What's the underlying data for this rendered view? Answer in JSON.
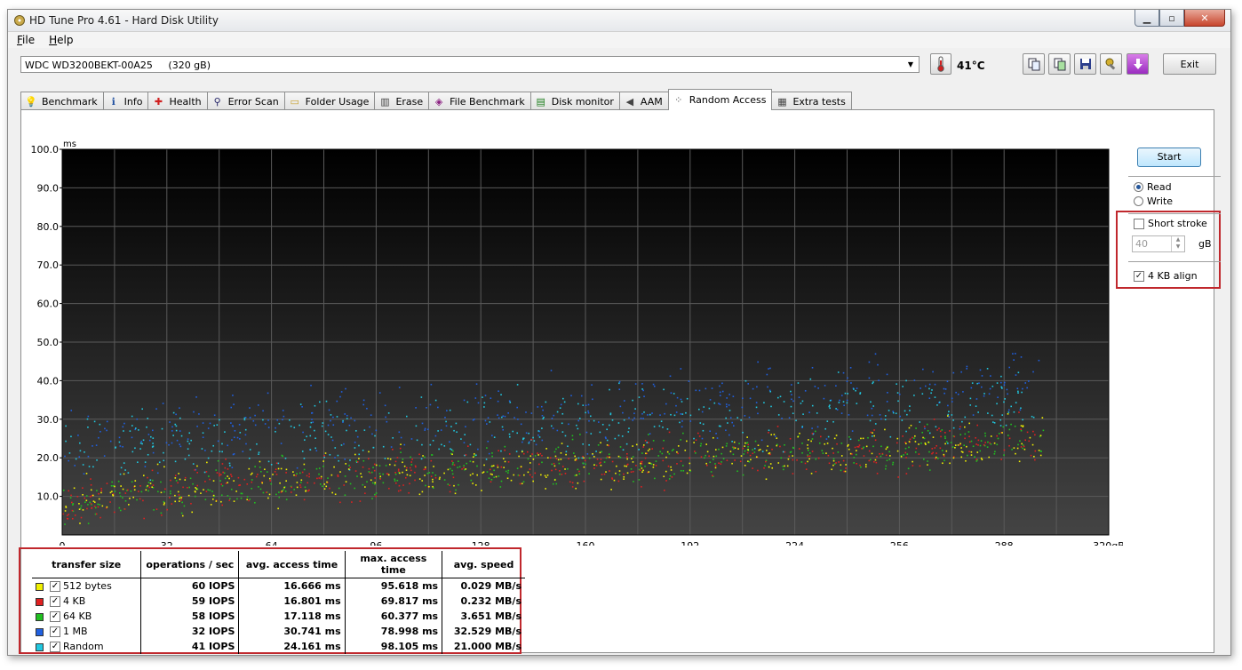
{
  "window": {
    "title": "HD Tune Pro 4.61 - Hard Disk Utility"
  },
  "menu": [
    {
      "label": "File",
      "u": "F",
      "rest": "ile"
    },
    {
      "label": "Help",
      "u": "H",
      "rest": "elp"
    }
  ],
  "toolbar": {
    "drive": "WDC WD3200BEKT-00A25     (320 gB)",
    "temperature": "41°C",
    "exit_label": "Exit"
  },
  "tabs": [
    {
      "label": "Benchmark",
      "icon": "bulb-icon"
    },
    {
      "label": "Info",
      "icon": "info-icon"
    },
    {
      "label": "Health",
      "icon": "health-cross-icon"
    },
    {
      "label": "Error Scan",
      "icon": "magnifier-icon"
    },
    {
      "label": "Folder Usage",
      "icon": "folder-icon"
    },
    {
      "label": "Erase",
      "icon": "trash-icon"
    },
    {
      "label": "File Benchmark",
      "icon": "file-bulb-icon"
    },
    {
      "label": "Disk monitor",
      "icon": "monitor-chart-icon"
    },
    {
      "label": "AAM",
      "icon": "speaker-icon"
    },
    {
      "label": "Random Access",
      "icon": "random-dots-icon",
      "active": true
    },
    {
      "label": "Extra tests",
      "icon": "table-icon"
    }
  ],
  "controls": {
    "start_label": "Start",
    "read_label": "Read",
    "write_label": "Write",
    "mode": "Read",
    "short_stroke_label": "Short stroke",
    "short_stroke_checked": false,
    "short_stroke_value": "40",
    "short_stroke_unit": "gB",
    "align_label": "4 KB align",
    "align_checked": true
  },
  "results": {
    "headers": [
      "transfer size",
      "operations / sec",
      "avg. access time",
      "max. access time",
      "avg. speed"
    ],
    "rows": [
      {
        "size": "512 bytes",
        "color": "#f0f000",
        "ops": "60 IOPS",
        "avg": "16.666 ms",
        "max": "95.618 ms",
        "speed": "0.029 MB/s"
      },
      {
        "size": "4 KB",
        "color": "#e02020",
        "ops": "59 IOPS",
        "avg": "16.801 ms",
        "max": "69.817 ms",
        "speed": "0.232 MB/s"
      },
      {
        "size": "64 KB",
        "color": "#20c020",
        "ops": "58 IOPS",
        "avg": "17.118 ms",
        "max": "60.377 ms",
        "speed": "3.651 MB/s"
      },
      {
        "size": "1 MB",
        "color": "#2060e0",
        "ops": "32 IOPS",
        "avg": "30.741 ms",
        "max": "78.998 ms",
        "speed": "32.529 MB/s"
      },
      {
        "size": "Random",
        "color": "#20c8e0",
        "ops": "41 IOPS",
        "avg": "24.161 ms",
        "max": "98.105 ms",
        "speed": "21.000 MB/s"
      }
    ]
  },
  "chart_data": {
    "type": "scatter",
    "ylabel": "ms",
    "ylim": [
      0,
      100
    ],
    "xlim": [
      0,
      320
    ],
    "y_ticks": [
      "10.0",
      "20.0",
      "30.0",
      "40.0",
      "50.0",
      "60.0",
      "70.0",
      "80.0",
      "90.0",
      "100.0"
    ],
    "x_ticks": [
      "0",
      "32",
      "64",
      "96",
      "128",
      "160",
      "192",
      "224",
      "256",
      "288",
      "320gB"
    ],
    "grid": true,
    "series": [
      {
        "name": "512 bytes",
        "color": "#f0f000",
        "trend": [
          [
            0,
            8
          ],
          [
            32,
            12
          ],
          [
            64,
            14
          ],
          [
            128,
            17
          ],
          [
            192,
            20
          ],
          [
            256,
            23
          ],
          [
            300,
            25
          ]
        ]
      },
      {
        "name": "4 KB",
        "color": "#e02020",
        "trend": [
          [
            0,
            8
          ],
          [
            32,
            12
          ],
          [
            64,
            14
          ],
          [
            128,
            17
          ],
          [
            192,
            20
          ],
          [
            256,
            23
          ],
          [
            300,
            25
          ]
        ]
      },
      {
        "name": "64 KB",
        "color": "#20c020",
        "trend": [
          [
            0,
            8
          ],
          [
            32,
            12
          ],
          [
            64,
            14
          ],
          [
            128,
            17
          ],
          [
            192,
            20
          ],
          [
            256,
            23
          ],
          [
            300,
            25
          ]
        ]
      },
      {
        "name": "1 MB",
        "color": "#2060e0",
        "trend": [
          [
            0,
            25
          ],
          [
            64,
            28
          ],
          [
            128,
            31
          ],
          [
            192,
            34
          ],
          [
            256,
            37
          ],
          [
            300,
            39
          ]
        ]
      },
      {
        "name": "Random",
        "color": "#20c8e0",
        "trend": [
          [
            0,
            22
          ],
          [
            64,
            24
          ],
          [
            128,
            27
          ],
          [
            192,
            30
          ],
          [
            256,
            33
          ],
          [
            300,
            35
          ]
        ]
      }
    ]
  }
}
